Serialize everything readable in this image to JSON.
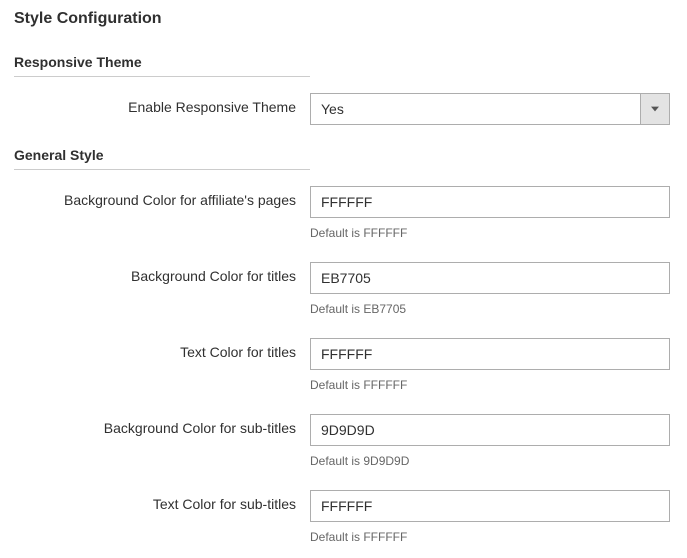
{
  "page_title": "Style Configuration",
  "sections": {
    "responsive": {
      "title": "Responsive Theme",
      "enable": {
        "label": "Enable Responsive Theme",
        "value": "Yes"
      }
    },
    "general": {
      "title": "General Style",
      "bg_affiliate": {
        "label": "Background Color for affiliate's pages",
        "value": "FFFFFF",
        "hint": "Default is FFFFFF"
      },
      "bg_titles": {
        "label": "Background Color for titles",
        "value": "EB7705",
        "hint": "Default is EB7705"
      },
      "text_titles": {
        "label": "Text Color for titles",
        "value": "FFFFFF",
        "hint": "Default is FFFFFF"
      },
      "bg_subtitles": {
        "label": "Background Color for sub-titles",
        "value": "9D9D9D",
        "hint": "Default is 9D9D9D"
      },
      "text_subtitles": {
        "label": "Text Color for sub-titles",
        "value": "FFFFFF",
        "hint": "Default is FFFFFF"
      }
    }
  }
}
